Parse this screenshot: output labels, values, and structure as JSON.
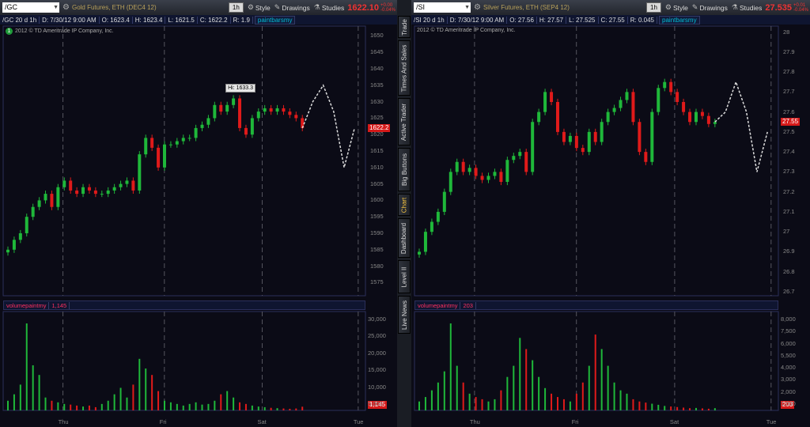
{
  "left": {
    "symbol": "/GC",
    "description": "Gold Futures, ETH (DEC4 12)",
    "timeframe": "1h",
    "buttons": {
      "style": "Style",
      "drawings": "Drawings",
      "studies": "Studies"
    },
    "last_price": "1622.10",
    "change_top": "+0.00",
    "change_bottom": "-0.04%",
    "info": {
      "period": "/GC 20 d 1h",
      "date": "D: 7/30/12 9:00 AM",
      "open": "O: 1623.4",
      "high": "H: 1623.4",
      "low": "L: 1621.5",
      "close": "C: 1622.2",
      "range": "R: 1.9",
      "study": "paintbarsmy"
    },
    "copyright": "2012 © TD Ameritrade IP Company, Inc.",
    "study_number": "1",
    "hi_label": "Hi: 1633.3",
    "price_tag": "1622.2",
    "volume_study": "volumepaintmy",
    "volume_value": "1,145",
    "volume_tag": "1,145",
    "price_ticks": [
      "1650",
      "1645",
      "1640",
      "1635",
      "1630",
      "1625",
      "1620",
      "1615",
      "1610",
      "1605",
      "1600",
      "1595",
      "1590",
      "1585",
      "1580",
      "1575"
    ],
    "volume_ticks": [
      "30,000",
      "25,000",
      "20,000",
      "15,000",
      "10,000",
      "5,000"
    ],
    "x_labels": [
      "Thu",
      "Fri",
      "Sat",
      "Tue"
    ]
  },
  "right": {
    "symbol": "/SI",
    "description": "Silver Futures, ETH (SEP4 12)",
    "timeframe": "1h",
    "buttons": {
      "style": "Style",
      "drawings": "Drawings",
      "studies": "Studies"
    },
    "last_price": "27.535",
    "change_top": "+0.01",
    "change_bottom": "-0.04%",
    "info": {
      "period": "/SI 20 d 1h",
      "date": "D: 7/30/12 9:00 AM",
      "open": "O: 27.56",
      "high": "H: 27.57",
      "low": "L: 27.525",
      "close": "C: 27.55",
      "range": "R: 0.045",
      "study": "paintbarsmy"
    },
    "copyright": "2012 © TD Ameritrade IP Company, Inc.",
    "price_tag": "27.55",
    "volume_study": "volumepaintmy",
    "volume_value": "203",
    "volume_tag": "203",
    "price_ticks": [
      "28",
      "27.9",
      "27.8",
      "27.7",
      "27.6",
      "27.5",
      "27.4",
      "27.3",
      "27.2",
      "27.1",
      "27",
      "26.9",
      "26.8",
      "26.7"
    ],
    "volume_ticks": [
      "8,000",
      "7,500",
      "6,000",
      "5,500",
      "4,000",
      "3,000",
      "2,000",
      "1,000"
    ],
    "x_labels": [
      "Thu",
      "Fri",
      "Sat",
      "Tue"
    ]
  },
  "sidebar": {
    "tabs": [
      "Trade",
      "Times And Sales",
      "Active Trader",
      "Big Buttons",
      "Chart",
      "Dashboard",
      "Level II",
      "Live News"
    ],
    "active": "Chart"
  },
  "colors": {
    "up": "#1fb83a",
    "down": "#e01a1a",
    "grid": "#3a3a46",
    "accent": "#f0c040"
  },
  "chart_data": [
    {
      "type": "candlestick",
      "title": "/GC 20 d 1h",
      "ylim": [
        1571,
        1653
      ],
      "yticks": [
        1650,
        1645,
        1640,
        1635,
        1630,
        1625,
        1620,
        1615,
        1610,
        1605,
        1600,
        1595,
        1590,
        1585,
        1580,
        1575
      ],
      "x_categories": [
        "Thu",
        "Fri",
        "Sat",
        "Tue"
      ],
      "close": [
        1585,
        1588,
        1590,
        1595,
        1598,
        1600,
        1602,
        1598,
        1604,
        1606,
        1603,
        1602,
        1604,
        1603,
        1602,
        1602,
        1603,
        1604,
        1605,
        1606,
        1603,
        1614,
        1619,
        1616,
        1610,
        1617,
        1617,
        1618,
        1619,
        1619,
        1622,
        1623,
        1625,
        1629,
        1627,
        1629,
        1631,
        1622,
        1620,
        1625,
        1627,
        1628,
        1627,
        1628,
        1627,
        1626,
        1625,
        1622
      ],
      "forecast": [
        1622,
        1630,
        1635,
        1627,
        1610,
        1622
      ],
      "volume": [
        3000,
        5000,
        8000,
        27000,
        14000,
        11000,
        4000,
        3000,
        2500,
        2000,
        1800,
        1500,
        1200,
        1500,
        1000,
        2000,
        3000,
        5000,
        7000,
        4000,
        8000,
        16000,
        13000,
        11000,
        6000,
        3000,
        2500,
        2000,
        1500,
        2000,
        2500,
        1800,
        2000,
        3000,
        5000,
        6000,
        4000,
        2500,
        2000,
        1500,
        1200,
        1000,
        800,
        700,
        600,
        500,
        600,
        1145
      ]
    },
    {
      "type": "candlestick",
      "title": "/SI 20 d 1h",
      "ylim": [
        26.68,
        28.03
      ],
      "yticks": [
        28,
        27.9,
        27.8,
        27.7,
        27.6,
        27.5,
        27.4,
        27.3,
        27.2,
        27.1,
        27,
        26.9,
        26.8,
        26.7
      ],
      "x_categories": [
        "Thu",
        "Fri",
        "Sat",
        "Tue"
      ],
      "close": [
        26.9,
        27.0,
        27.05,
        27.1,
        27.2,
        27.3,
        27.35,
        27.3,
        27.32,
        27.28,
        27.26,
        27.28,
        27.3,
        27.25,
        27.36,
        27.38,
        27.4,
        27.3,
        27.55,
        27.6,
        27.7,
        27.65,
        27.5,
        27.45,
        27.48,
        27.42,
        27.4,
        27.5,
        27.45,
        27.55,
        27.6,
        27.62,
        27.66,
        27.7,
        27.55,
        27.4,
        27.35,
        27.6,
        27.72,
        27.75,
        27.7,
        27.65,
        27.6,
        27.55,
        27.6,
        27.58,
        27.54,
        27.55
      ],
      "forecast": [
        27.55,
        27.6,
        27.75,
        27.6,
        27.3,
        27.5
      ],
      "volume": [
        800,
        1200,
        1800,
        2500,
        3500,
        7800,
        4000,
        2500,
        1500,
        1200,
        1000,
        800,
        1000,
        1800,
        3000,
        4000,
        6500,
        5500,
        4500,
        3000,
        2000,
        1500,
        1200,
        1000,
        800,
        1500,
        2500,
        4000,
        6800,
        5500,
        4000,
        2500,
        1800,
        1500,
        1000,
        800,
        700,
        600,
        500,
        400,
        350,
        300,
        250,
        200,
        220,
        180,
        150,
        203
      ]
    }
  ]
}
